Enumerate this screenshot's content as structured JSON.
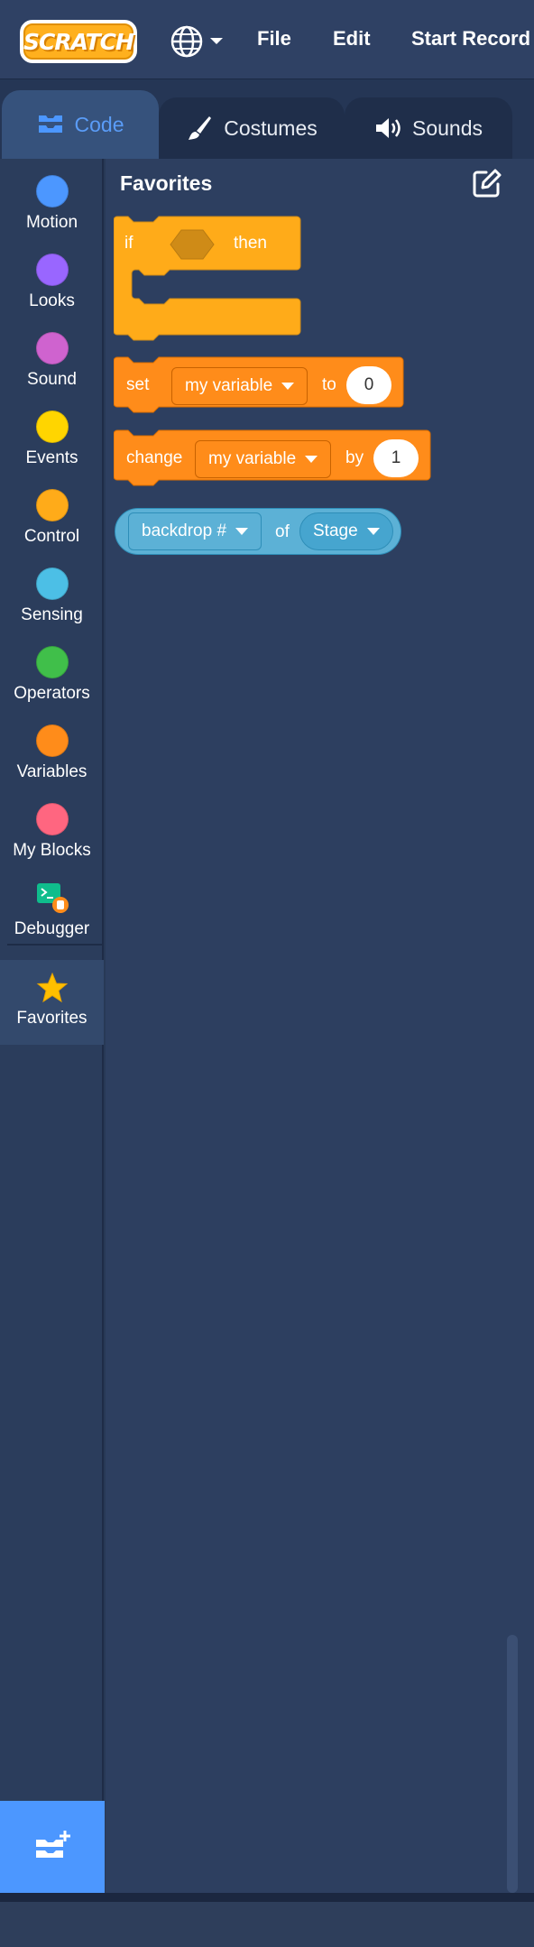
{
  "menubar": {
    "logo_text": "SCRATCH",
    "language_icon": "globe-icon",
    "items": [
      "File",
      "Edit",
      "Start Record"
    ]
  },
  "tabs": [
    {
      "label": "Code",
      "icon": "code-blocks-icon",
      "active": true
    },
    {
      "label": "Costumes",
      "icon": "paintbrush-icon",
      "active": false
    },
    {
      "label": "Sounds",
      "icon": "speaker-icon",
      "active": false
    }
  ],
  "categories": [
    {
      "label": "Motion",
      "color": "#4c97ff"
    },
    {
      "label": "Looks",
      "color": "#9966ff"
    },
    {
      "label": "Sound",
      "color": "#cf63cf"
    },
    {
      "label": "Events",
      "color": "#ffd500"
    },
    {
      "label": "Control",
      "color": "#ffab19"
    },
    {
      "label": "Sensing",
      "color": "#4cbfe6"
    },
    {
      "label": "Operators",
      "color": "#40bf4a"
    },
    {
      "label": "Variables",
      "color": "#ff8c1a"
    },
    {
      "label": "My Blocks",
      "color": "#ff6680"
    },
    {
      "label": "Debugger",
      "icon": "debugger-icon"
    },
    {
      "label": "Favorites",
      "icon": "star-icon",
      "selected": true
    }
  ],
  "flyout": {
    "title": "Favorites",
    "edit_icon": "edit-icon",
    "blocks": {
      "if_then": {
        "if": "if",
        "then": "then"
      },
      "set_var": {
        "set": "set",
        "variable": "my variable",
        "to": "to",
        "value": "0"
      },
      "change_var": {
        "change": "change",
        "variable": "my variable",
        "by": "by",
        "value": "1"
      },
      "sensing_of": {
        "property": "backdrop #",
        "of": "of",
        "object": "Stage"
      }
    }
  },
  "extension_button_icon": "add-extension-icon",
  "colors": {
    "control": "#ffab19",
    "variables": "#ff8c1a",
    "sensing": "#5cb1d6",
    "accent": "#4c97ff"
  }
}
